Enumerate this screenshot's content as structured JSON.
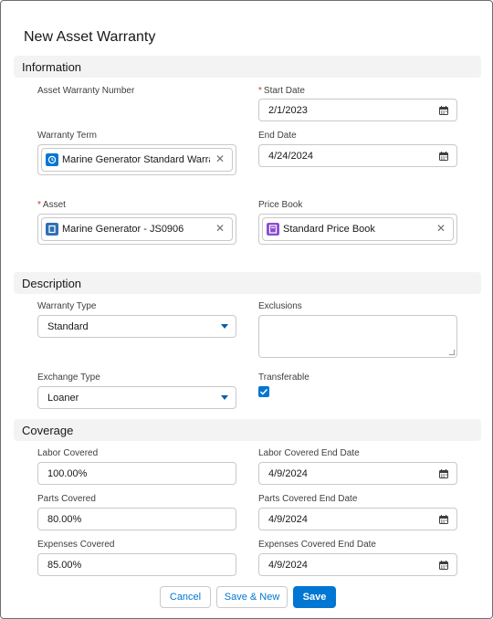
{
  "title": "New Asset Warranty",
  "sections": {
    "information": "Information",
    "description": "Description",
    "coverage": "Coverage"
  },
  "fields": {
    "asset_warranty_number": {
      "label": "Asset Warranty Number"
    },
    "start_date": {
      "label": "Start Date",
      "value": "2/1/2023",
      "required": true
    },
    "warranty_term": {
      "label": "Warranty Term",
      "value": "Marine Generator Standard Warran..."
    },
    "end_date": {
      "label": "End Date",
      "value": "4/24/2024"
    },
    "asset": {
      "label": "Asset",
      "value": "Marine Generator - JS0906",
      "required": true
    },
    "price_book": {
      "label": "Price Book",
      "value": "Standard Price Book"
    },
    "warranty_type": {
      "label": "Warranty Type",
      "value": "Standard"
    },
    "exclusions": {
      "label": "Exclusions",
      "value": ""
    },
    "exchange_type": {
      "label": "Exchange Type",
      "value": "Loaner"
    },
    "transferable": {
      "label": "Transferable",
      "checked": true
    },
    "labor_covered": {
      "label": "Labor Covered",
      "value": "100.00%"
    },
    "labor_covered_end_date": {
      "label": "Labor Covered End Date",
      "value": "4/9/2024"
    },
    "parts_covered": {
      "label": "Parts Covered",
      "value": "80.00%"
    },
    "parts_covered_end_date": {
      "label": "Parts Covered End Date",
      "value": "4/9/2024"
    },
    "expenses_covered": {
      "label": "Expenses Covered",
      "value": "85.00%"
    },
    "expenses_covered_end_date": {
      "label": "Expenses Covered End Date",
      "value": "4/9/2024"
    }
  },
  "required_marker": "*",
  "clear_glyph": "✕",
  "buttons": {
    "cancel": "Cancel",
    "save_new": "Save & New",
    "save": "Save"
  },
  "colors": {
    "brand": "#0176d3",
    "warranty_term_icon": "#0176d3",
    "asset_icon": "#2e6fb5",
    "price_book_icon": "#8a4ecf",
    "required": "#c23934"
  },
  "icons": {
    "calendar": "calendar-icon",
    "warranty_term": "warranty-term-icon",
    "asset": "asset-icon",
    "price_book": "price-book-icon"
  }
}
